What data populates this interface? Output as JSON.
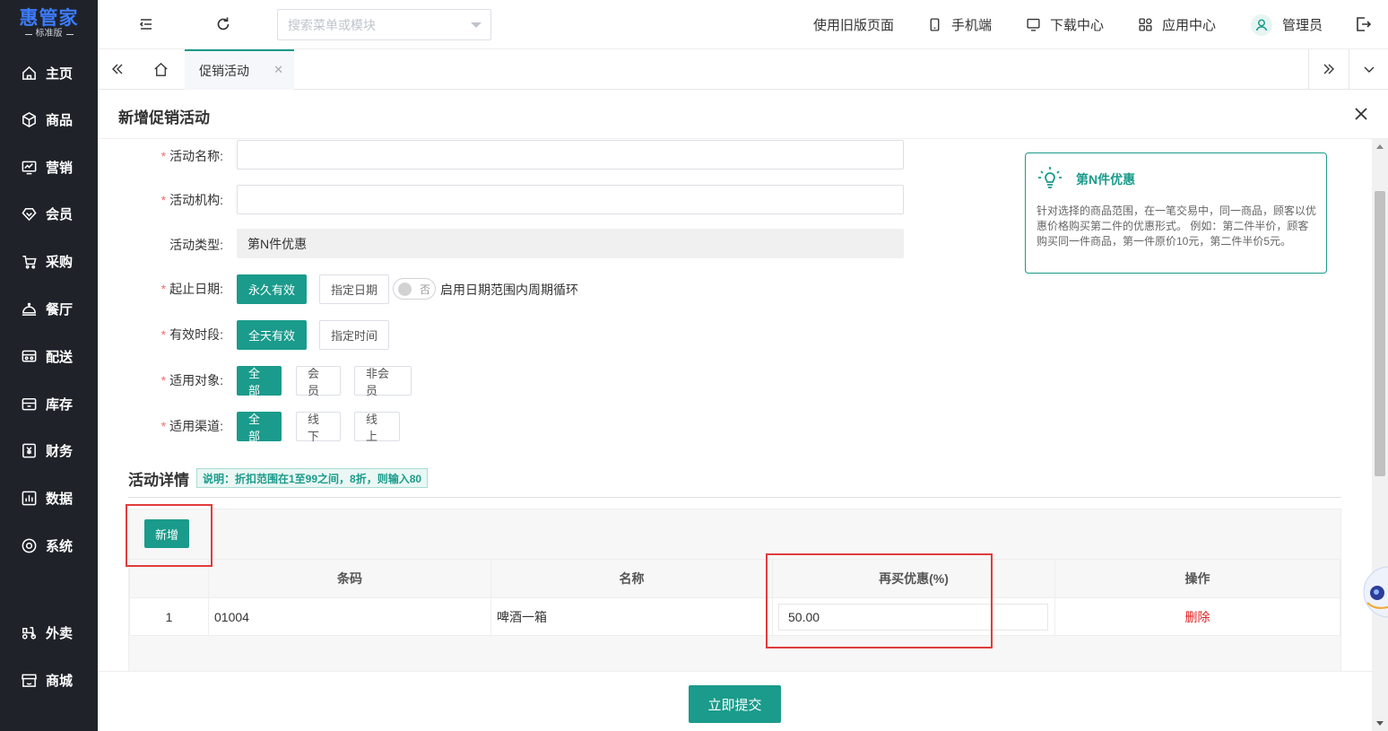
{
  "app": {
    "logo": "惠管家",
    "edition": "标准版"
  },
  "sidebar": {
    "items": [
      {
        "label": "主页",
        "icon": "home-icon"
      },
      {
        "label": "商品",
        "icon": "box-icon"
      },
      {
        "label": "营销",
        "icon": "chart-icon"
      },
      {
        "label": "会员",
        "icon": "diamond-icon"
      },
      {
        "label": "采购",
        "icon": "cart-icon"
      },
      {
        "label": "餐厅",
        "icon": "dish-icon"
      },
      {
        "label": "配送",
        "icon": "truck-icon"
      },
      {
        "label": "库存",
        "icon": "warehouse-icon"
      },
      {
        "label": "财务",
        "icon": "yen-icon"
      },
      {
        "label": "数据",
        "icon": "bar-chart-icon"
      },
      {
        "label": "系统",
        "icon": "gear-icon"
      },
      {
        "label": "外卖",
        "icon": "scooter-icon"
      },
      {
        "label": "商城",
        "icon": "store-icon"
      }
    ]
  },
  "header": {
    "search_placeholder": "搜索菜单或模块",
    "links": {
      "old_version": "使用旧版页面",
      "mobile": "手机端",
      "download": "下载中心",
      "apps": "应用中心",
      "user": "管理员"
    }
  },
  "tabs": [
    {
      "label": "促销活动"
    }
  ],
  "dialog": {
    "title": "新增促销活动",
    "form": {
      "name_label": "活动名称:",
      "org_label": "活动机构:",
      "type_label": "活动类型:",
      "type_value": "第N件优惠",
      "date_label": "起止日期:",
      "date_options": [
        "永久有效",
        "指定日期"
      ],
      "cycle_switch_state": "否",
      "cycle_text": "启用日期范围内周期循环",
      "time_label": "有效时段:",
      "time_options": [
        "全天有效",
        "指定时间"
      ],
      "target_label": "适用对象:",
      "target_options": [
        "全部",
        "会员",
        "非会员"
      ],
      "channel_label": "适用渠道:",
      "channel_options": [
        "全部",
        "线下",
        "线上"
      ]
    },
    "tip": {
      "title": "第N件优惠",
      "desc": "针对选择的商品范围，在一笔交易中，同一商品，顾客以优惠价格购买第二件的优惠形式。 例如：第二件半价，顾客购买同一件商品，第一件原价10元，第二件半价5元。"
    },
    "details": {
      "title": "活动详情",
      "note": "说明：折扣范围在1至99之间，8折，则输入80",
      "add_label": "新增",
      "columns": [
        "",
        "条码",
        "名称",
        "再买优惠(%)",
        "操作"
      ],
      "rows": [
        {
          "index": "1",
          "barcode": "01004",
          "name": "啤酒一箱",
          "discount": "50.00",
          "action": "删除"
        }
      ]
    },
    "submit_label": "立即提交"
  },
  "colors": {
    "primary": "#1a9b8b",
    "sidebar": "#1f2329",
    "logo": "#3d7bff",
    "danger": "#e02020",
    "highlight": "#e03c3c"
  }
}
